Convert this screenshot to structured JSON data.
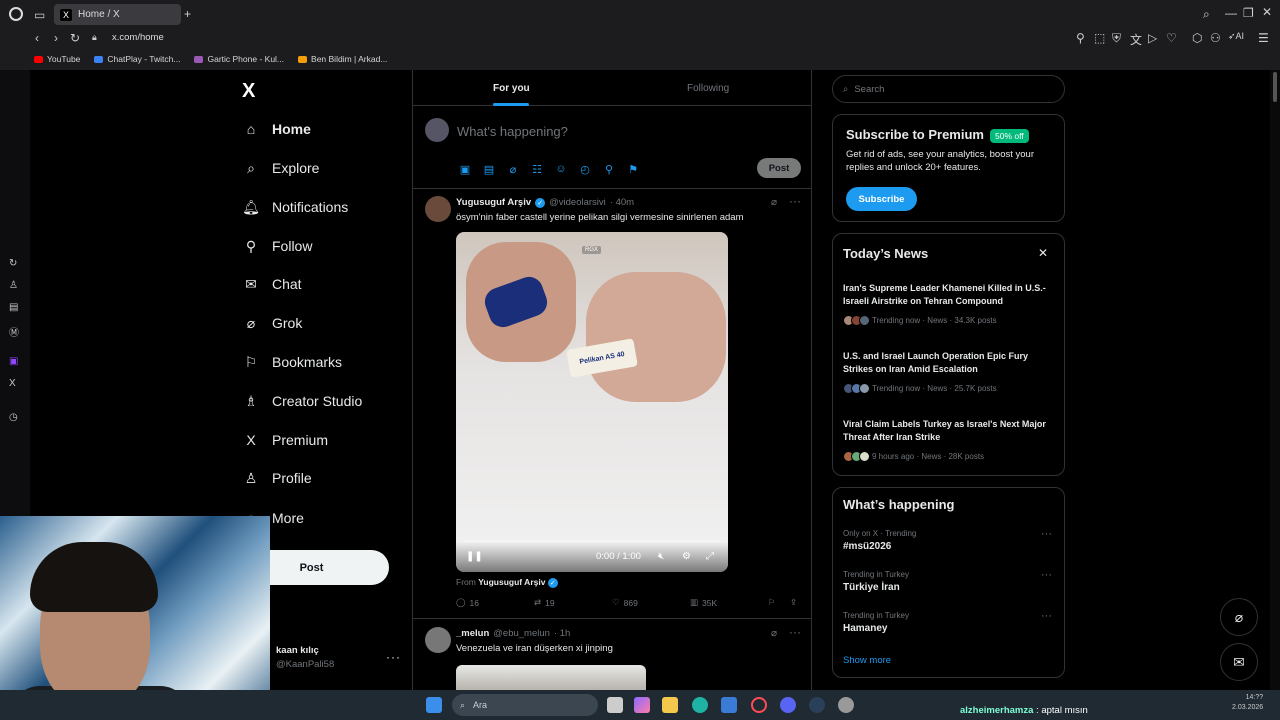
{
  "browser": {
    "tab_title": "Home / X",
    "url": "x.com/home",
    "bookmarks": [
      {
        "label": "YouTube",
        "color": "#ff0000"
      },
      {
        "label": "ChatPlay - Twitch...",
        "color": "#3b82f6"
      },
      {
        "label": "Gartic Phone - Kul...",
        "color": "#9b59b6"
      },
      {
        "label": "Ben Bildim | Arkad...",
        "color": "#f59e0b"
      }
    ]
  },
  "nav": {
    "logo": "X",
    "items": [
      {
        "label": "Home",
        "icon": "home-icon"
      },
      {
        "label": "Explore",
        "icon": "search-icon"
      },
      {
        "label": "Notifications",
        "icon": "bell-icon"
      },
      {
        "label": "Follow",
        "icon": "person-add-icon"
      },
      {
        "label": "Chat",
        "icon": "mail-icon"
      },
      {
        "label": "Grok",
        "icon": "grok-icon"
      },
      {
        "label": "Bookmarks",
        "icon": "bookmark-icon"
      },
      {
        "label": "Creator Studio",
        "icon": "creator-icon"
      },
      {
        "label": "Premium",
        "icon": "x-icon"
      },
      {
        "label": "Profile",
        "icon": "person-icon"
      },
      {
        "label": "More",
        "icon": "more-circle-icon"
      }
    ],
    "post_label": "Post",
    "account": {
      "name": "kaan kılıç",
      "handle": "@KaanPali58"
    }
  },
  "feed": {
    "tabs": [
      "For you",
      "Following"
    ],
    "composer": {
      "placeholder": "What's happening?",
      "post_label": "Post"
    },
    "tweets": [
      {
        "name": "Yugusuguf Arşiv",
        "handle": "@videolarsivi",
        "time": "· 40m",
        "text": "ösym'nin faber castell yerine pelikan silgi vermesine sinirlenen adam",
        "video": {
          "time": "0:00 / 1:00",
          "watermark": "RGX",
          "eraser_text": "Pelikan AS 40"
        },
        "from_prefix": "From",
        "from_name": "Yugusuguf Arşiv",
        "replies": "16",
        "reposts": "19",
        "likes": "869",
        "views": "35K"
      },
      {
        "name": "_melun",
        "handle": "@ebu_melun",
        "time": "· 1h",
        "text": "Venezuela ve iran düşerken xi jinping"
      }
    ]
  },
  "sidebar": {
    "search_placeholder": "Search",
    "premium": {
      "title": "Subscribe to Premium",
      "badge": "50% off",
      "desc": "Get rid of ads, see your analytics, boost your replies and unlock 20+ features.",
      "button": "Subscribe"
    },
    "news": {
      "title": "Today’s News",
      "items": [
        {
          "title": "Iran's Supreme Leader Khamenei Killed in U.S.-Israeli Airstrike on Tehran Compound",
          "meta": "Trending now · News · 34.3K posts"
        },
        {
          "title": "U.S. and Israel Launch Operation Epic Fury Strikes on Iran Amid Escalation",
          "meta": "Trending now · News · 25.7K posts"
        },
        {
          "title": "Viral Claim Labels Turkey as Israel's Next Major Threat After Iran Strike",
          "meta": "9 hours ago · News · 28K posts"
        }
      ]
    },
    "happening": {
      "title": "What’s happening",
      "items": [
        {
          "category": "Only on X · Trending",
          "name": "#msü2026"
        },
        {
          "category": "Trending in Turkey",
          "name": "Türkiye İran"
        },
        {
          "category": "Trending in Turkey",
          "name": "Hamaney"
        }
      ],
      "show_more": "Show more"
    }
  },
  "taskbar": {
    "search_placeholder": "Ara",
    "chat_user": "alzheimerhamza",
    "chat_msg": ": aptal mısın",
    "clock_time": "14:??",
    "clock_date": "2.03.2026"
  },
  "colors": {
    "accent": "#1d9bf0",
    "badge": "#00ba7c",
    "bg": "#000000",
    "border": "#2f3336",
    "muted": "#71767b"
  }
}
